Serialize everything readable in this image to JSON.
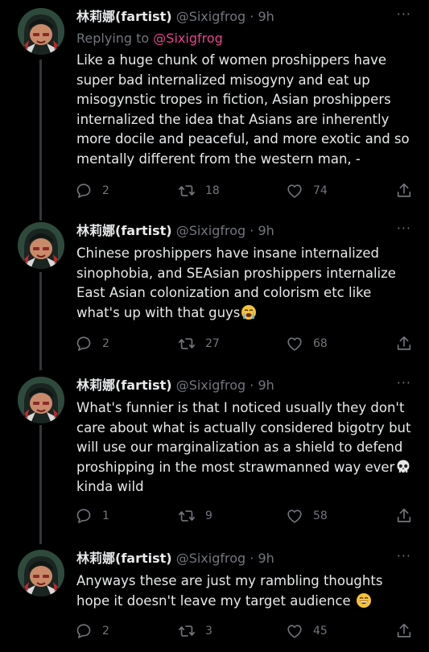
{
  "tweets": [
    {
      "name": "林莉娜(fartist)",
      "handle": "@Sixigfrog",
      "time": "9h",
      "replying_label": "Replying to ",
      "replying_to": "@Sixigfrog",
      "text": "Like a huge chunk of women proshippers have super bad internalized misogyny and eat up misogynstic tropes in fiction, Asian proshippers internalized the idea that Asians are inherently more docile and peaceful, and more exotic and so mentally different from the western man, -",
      "replies": "2",
      "retweets": "18",
      "likes": "74"
    },
    {
      "name": "林莉娜(fartist)",
      "handle": "@Sixigfrog",
      "time": "9h",
      "text": "Chinese proshippers have insane internalized sinophobia, and SEAsian proshippers internalize East Asian colonization and colorism etc like what's up with that guys",
      "emoji": "loudly-crying-face",
      "replies": "2",
      "retweets": "27",
      "likes": "68"
    },
    {
      "name": "林莉娜(fartist)",
      "handle": "@Sixigfrog",
      "time": "9h",
      "text": "What's funnier is that I noticed usually they don't care about what is actually considered bigotry but will use our marginalization as a shield to defend proshipping in the most strawmanned way ever",
      "emoji": "skull",
      "text_after": "kinda wild",
      "replies": "1",
      "retweets": "9",
      "likes": "58"
    },
    {
      "name": "林莉娜(fartist)",
      "handle": "@Sixigfrog",
      "time": "9h",
      "text": "Anyways these are just my rambling thoughts hope it doesn't leave my target audience",
      "emoji": "grinning-face",
      "replies": "2",
      "retweets": "3",
      "likes": "45"
    }
  ],
  "separator": "·",
  "colors": {
    "background": "#000000",
    "text": "#e7e9ea",
    "muted": "#71767b",
    "mention": "#e7458d"
  }
}
